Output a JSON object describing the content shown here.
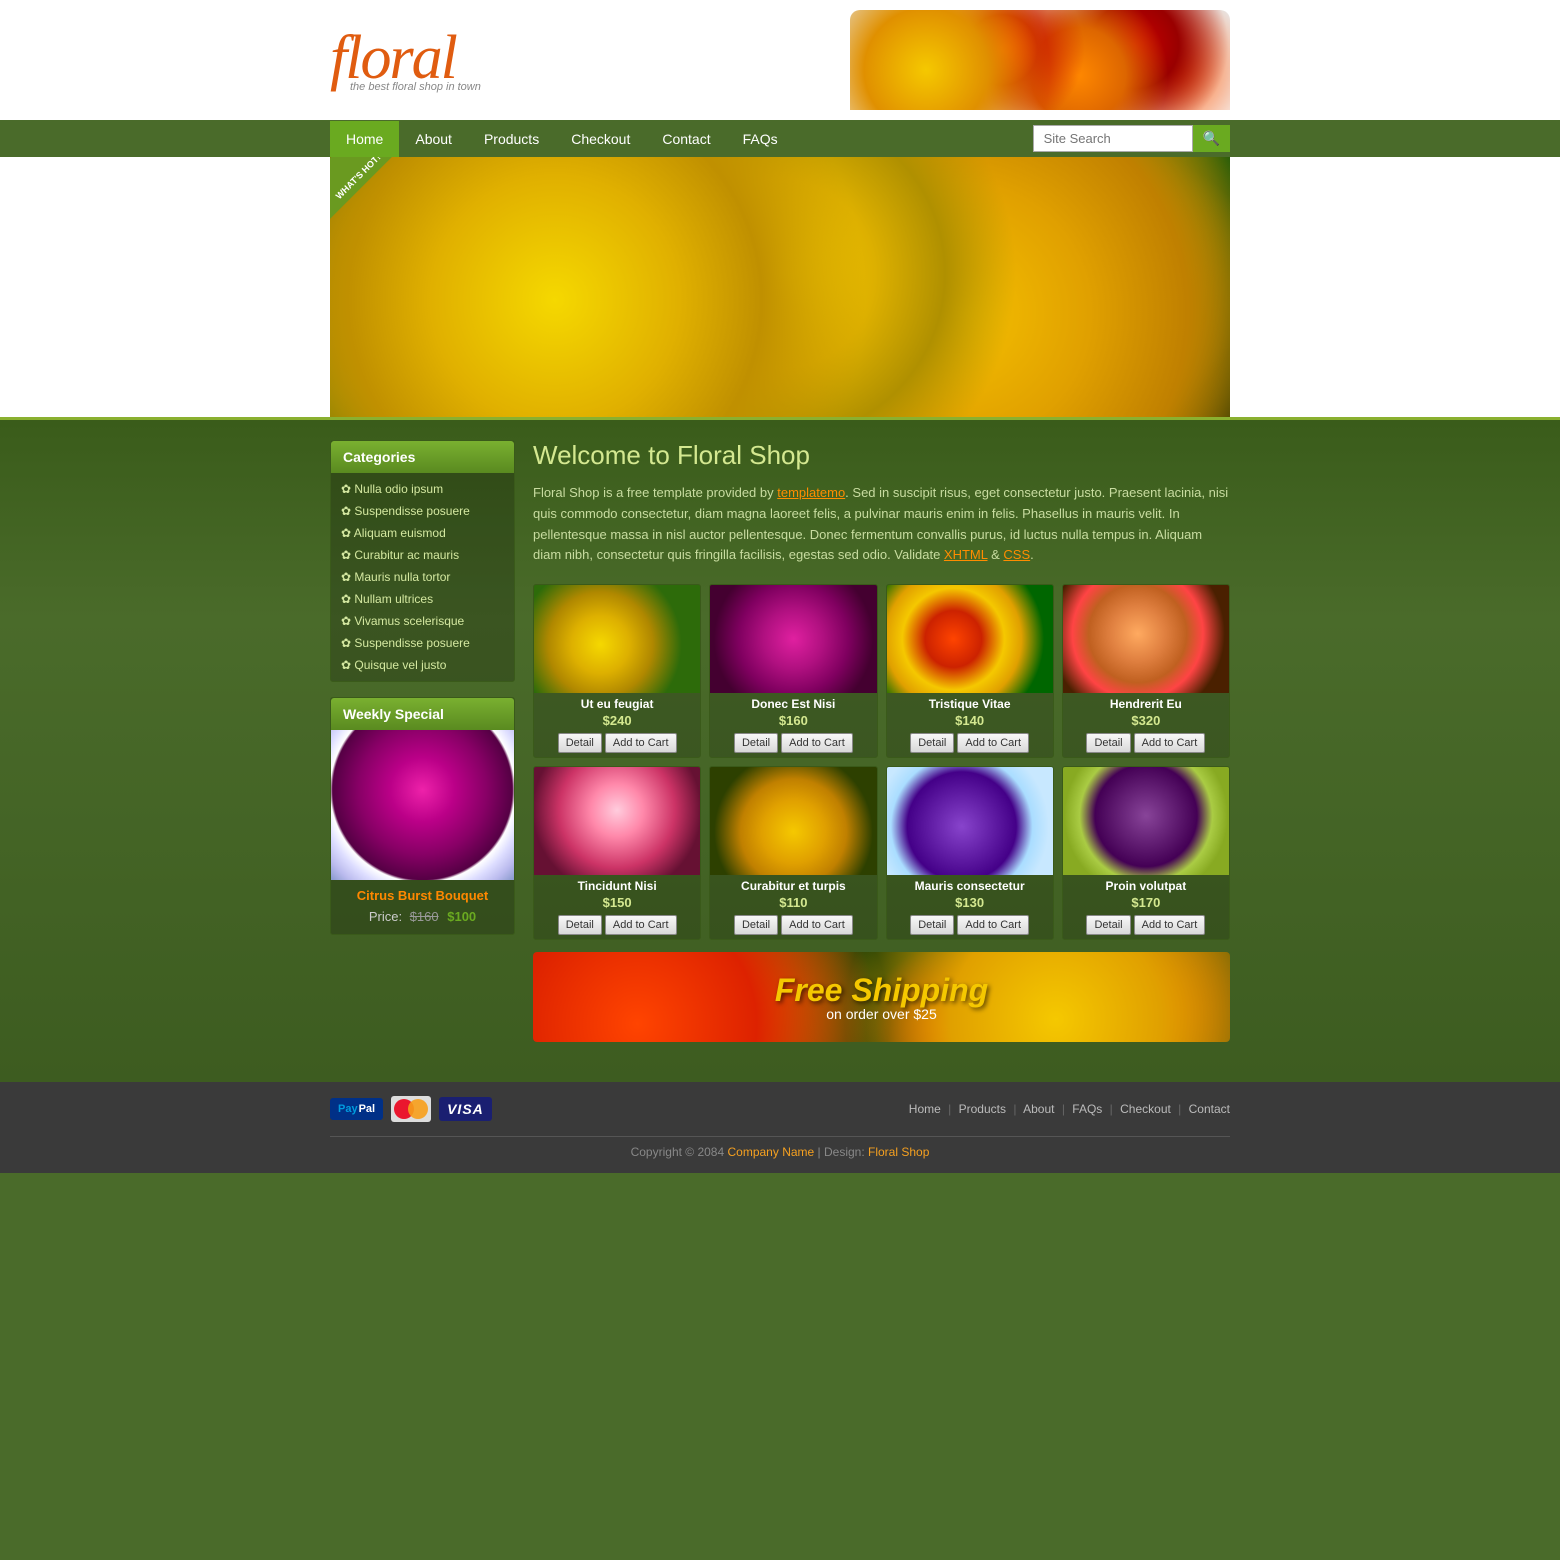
{
  "site": {
    "logo": "floral",
    "tagline": "the best floral shop in town"
  },
  "nav": {
    "items": [
      {
        "label": "Home",
        "active": true
      },
      {
        "label": "About"
      },
      {
        "label": "Products"
      },
      {
        "label": "Checkout"
      },
      {
        "label": "Contact"
      },
      {
        "label": "FAQs"
      }
    ],
    "search_placeholder": "Site Search"
  },
  "hero": {
    "badge": "WHAT'S HOT!"
  },
  "categories": {
    "title": "Categories",
    "items": [
      "Nulla odio ipsum",
      "Suspendisse posuere",
      "Aliquam euismod",
      "Curabitur ac mauris",
      "Mauris nulla tortor",
      "Nullam ultrices",
      "Vivamus scelerisque",
      "Suspendisse posuere",
      "Quisque vel justo"
    ]
  },
  "weekly_special": {
    "title": "Weekly Special",
    "product_name": "Citrus Burst Bouquet",
    "old_price": "$160",
    "new_price": "$100",
    "price_label": "Price:"
  },
  "welcome": {
    "title": "Welcome to Floral Shop",
    "text1": "Floral Shop is a free template provided by ",
    "link_text": "templatemo",
    "link_url": "#",
    "text2": ". Sed in suscipit risus, eget consectetur justo. Praesent lacinia, nisi quis commodo consectetur, diam magna laoreet felis, a pulvinar mauris enim in felis. Phasellus in mauris velit. In pellentesque massa in nisl auctor pellentesque. Donec fermentum convallis purus, id luctus nulla tempus in. Aliquam diam nibh, consectetur quis fringilla facilisis, egestas sed odio. Validate ",
    "xhtml": "XHTML",
    "and": " & ",
    "css": "CSS",
    "period": "."
  },
  "products": [
    {
      "id": 1,
      "name": "Ut eu feugiat",
      "price": "$240",
      "color_class": "p1"
    },
    {
      "id": 2,
      "name": "Donec Est Nisi",
      "price": "$160",
      "color_class": "p2"
    },
    {
      "id": 3,
      "name": "Tristique Vitae",
      "price": "$140",
      "color_class": "p3"
    },
    {
      "id": 4,
      "name": "Hendrerit Eu",
      "price": "$320",
      "color_class": "p4"
    },
    {
      "id": 5,
      "name": "Tincidunt Nisi",
      "price": "$150",
      "color_class": "p5"
    },
    {
      "id": 6,
      "name": "Curabitur et turpis",
      "price": "$110",
      "color_class": "p6"
    },
    {
      "id": 7,
      "name": "Mauris consectetur",
      "price": "$130",
      "color_class": "p7"
    },
    {
      "id": 8,
      "name": "Proin volutpat",
      "price": "$170",
      "color_class": "p8"
    }
  ],
  "product_buttons": {
    "detail": "Detail",
    "add_to_cart": "Add to Cart"
  },
  "free_shipping": {
    "main": "Free Shipping",
    "sub": "on order over $25"
  },
  "footer": {
    "nav_items": [
      "Home",
      "Products",
      "About",
      "FAQs",
      "Checkout",
      "Contact"
    ],
    "copyright": "Copyright © 2084",
    "company_name": "Company Name",
    "design_label": "Design:",
    "design_name": "Floral Shop"
  }
}
